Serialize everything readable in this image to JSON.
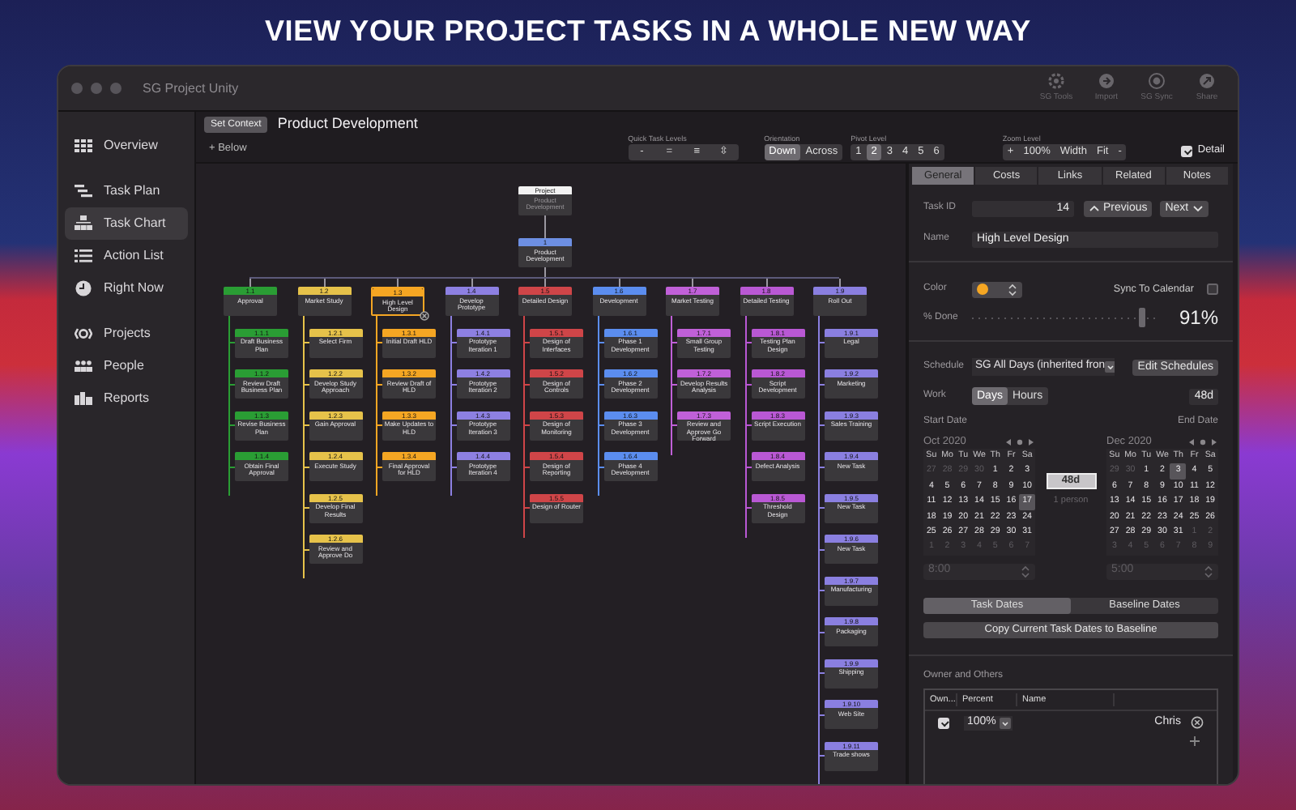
{
  "headline": "VIEW YOUR PROJECT TASKS IN A WHOLE NEW WAY",
  "window": {
    "title": "SG Project Unity"
  },
  "toolbar": [
    {
      "label": "SG Tools"
    },
    {
      "label": "Import"
    },
    {
      "label": "SG Sync"
    },
    {
      "label": "Share"
    }
  ],
  "sidebar": {
    "groups": [
      [
        {
          "label": "Overview",
          "selected": false
        }
      ],
      [
        {
          "label": "Task Plan",
          "selected": false
        },
        {
          "label": "Task Chart",
          "selected": true
        },
        {
          "label": "Action List",
          "selected": false
        },
        {
          "label": "Right Now",
          "selected": false
        }
      ],
      [
        {
          "label": "Projects",
          "selected": false
        },
        {
          "label": "People",
          "selected": false
        },
        {
          "label": "Reports",
          "selected": false
        }
      ]
    ]
  },
  "context": {
    "button": "Set Context",
    "title": "Product Development",
    "add_button": "+ Below"
  },
  "controls": {
    "quick_levels": {
      "label": "Quick Task Levels",
      "buttons": [
        "-",
        "=",
        "≡",
        "⇳"
      ]
    },
    "orientation": {
      "label": "Orientation",
      "options": [
        {
          "label": "Down",
          "selected": true
        },
        {
          "label": "Across",
          "selected": false
        }
      ]
    },
    "pivot": {
      "label": "Pivot Level",
      "options": [
        {
          "label": "1",
          "selected": false
        },
        {
          "label": "2",
          "selected": true
        },
        {
          "label": "3",
          "selected": false
        },
        {
          "label": "4",
          "selected": false
        },
        {
          "label": "5",
          "selected": false
        },
        {
          "label": "6",
          "selected": false
        }
      ]
    },
    "zoom": {
      "label": "Zoom Level",
      "buttons": [
        "+",
        "100%",
        "Width",
        "Fit",
        "-"
      ]
    },
    "detail": {
      "label": "Detail",
      "checked": true
    }
  },
  "chart": {
    "project": {
      "label": "Project",
      "name": "Product Development",
      "selected": false,
      "children": [
        {
          "number": "1",
          "name": "Product Development",
          "color": "#6d8fe3",
          "selected": false,
          "children": [
            {
              "number": "1.1",
              "name": "Approval",
              "color": "#2a9d34",
              "selected": false,
              "children": [
                {
                  "number": "1.1.1",
                  "name": "Draft Business Plan",
                  "selected": false
                },
                {
                  "number": "1.1.2",
                  "name": "Review Draft Business Plan",
                  "selected": false
                },
                {
                  "number": "1.1.3",
                  "name": "Revise Business Plan",
                  "selected": false
                },
                {
                  "number": "1.1.4",
                  "name": "Obtain Final Approval",
                  "selected": false
                }
              ]
            },
            {
              "number": "1.2",
              "name": "Market Study",
              "color": "#e6c24a",
              "selected": false,
              "children": [
                {
                  "number": "1.2.1",
                  "name": "Select Firm",
                  "selected": false
                },
                {
                  "number": "1.2.2",
                  "name": "Develop Study Approach",
                  "selected": false
                },
                {
                  "number": "1.2.3",
                  "name": "Gain Approval",
                  "selected": false
                },
                {
                  "number": "1.2.4",
                  "name": "Execute Study",
                  "selected": false
                },
                {
                  "number": "1.2.5",
                  "name": "Develop Final Results",
                  "selected": false
                },
                {
                  "number": "1.2.6",
                  "name": "Review and Approve Do",
                  "selected": false
                }
              ]
            },
            {
              "number": "1.3",
              "name": "High Level Design",
              "color": "#f5a623",
              "selected": true,
              "children": [
                {
                  "number": "1.3.1",
                  "name": "Initial Draft HLD",
                  "selected": false
                },
                {
                  "number": "1.3.2",
                  "name": "Review Draft of HLD",
                  "selected": false
                },
                {
                  "number": "1.3.3",
                  "name": "Make Updates to HLD",
                  "selected": false
                },
                {
                  "number": "1.3.4",
                  "name": "Final Approval for HLD",
                  "selected": false
                }
              ]
            },
            {
              "number": "1.4",
              "name": "Develop Prototype",
              "color": "#8d80e2",
              "selected": false,
              "children": [
                {
                  "number": "1.4.1",
                  "name": "Prototype Iteration 1",
                  "selected": false
                },
                {
                  "number": "1.4.2",
                  "name": "Prototype Iteration 2",
                  "selected": false
                },
                {
                  "number": "1.4.3",
                  "name": "Prototype Iteration 3",
                  "selected": false
                },
                {
                  "number": "1.4.4",
                  "name": "Prototype Iteration 4",
                  "selected": false
                }
              ]
            },
            {
              "number": "1.5",
              "name": "Detailed Design",
              "color": "#cf4548",
              "selected": false,
              "children": [
                {
                  "number": "1.5.1",
                  "name": "Design of Interfaces",
                  "selected": false
                },
                {
                  "number": "1.5.2",
                  "name": "Design of Controls",
                  "selected": false
                },
                {
                  "number": "1.5.3",
                  "name": "Design of Monitoring",
                  "selected": false
                },
                {
                  "number": "1.5.4",
                  "name": "Design of Reporting",
                  "selected": false
                },
                {
                  "number": "1.5.5",
                  "name": "Design of Router",
                  "selected": false
                }
              ]
            },
            {
              "number": "1.6",
              "name": "Development",
              "color": "#5b8def",
              "selected": false,
              "children": [
                {
                  "number": "1.6.1",
                  "name": "Phase 1 Development",
                  "selected": false
                },
                {
                  "number": "1.6.2",
                  "name": "Phase 2 Development",
                  "selected": false
                },
                {
                  "number": "1.6.3",
                  "name": "Phase 3 Development",
                  "selected": false
                },
                {
                  "number": "1.6.4",
                  "name": "Phase 4 Development",
                  "selected": false
                }
              ]
            },
            {
              "number": "1.7",
              "name": "Market Testing",
              "color": "#c060d8",
              "selected": false,
              "children": [
                {
                  "number": "1.7.1",
                  "name": "Small Group Testing",
                  "selected": false
                },
                {
                  "number": "1.7.2",
                  "name": "Develop Results Analysis",
                  "selected": false
                },
                {
                  "number": "1.7.3",
                  "name": "Review and Approve Go Forward",
                  "selected": false
                }
              ]
            },
            {
              "number": "1.8",
              "name": "Detailed Testing",
              "color": "#b958d4",
              "selected": false,
              "children": [
                {
                  "number": "1.8.1",
                  "name": "Testing Plan Design",
                  "selected": false
                },
                {
                  "number": "1.8.2",
                  "name": "Script Development",
                  "selected": false
                },
                {
                  "number": "1.8.3",
                  "name": "Script Execution",
                  "selected": false
                },
                {
                  "number": "1.8.4",
                  "name": "Defect Analysis",
                  "selected": false
                },
                {
                  "number": "1.8.5",
                  "name": "Threshold Design",
                  "selected": false
                }
              ]
            },
            {
              "number": "1.9",
              "name": "Roll Out",
              "color": "#8a7fe0",
              "selected": false,
              "children": [
                {
                  "number": "1.9.1",
                  "name": "Legal",
                  "selected": false
                },
                {
                  "number": "1.9.2",
                  "name": "Marketing",
                  "selected": false
                },
                {
                  "number": "1.9.3",
                  "name": "Sales Training",
                  "selected": false
                },
                {
                  "number": "1.9.4",
                  "name": "New Task",
                  "selected": false
                },
                {
                  "number": "1.9.5",
                  "name": "New Task",
                  "selected": false
                },
                {
                  "number": "1.9.6",
                  "name": "New Task",
                  "selected": false
                },
                {
                  "number": "1.9.7",
                  "name": "Manufacturing",
                  "selected": false
                },
                {
                  "number": "1.9.8",
                  "name": "Packaging",
                  "selected": false
                },
                {
                  "number": "1.9.9",
                  "name": "Shipping",
                  "selected": false
                },
                {
                  "number": "1.9.10",
                  "name": "Web Site",
                  "selected": false
                },
                {
                  "number": "1.9.11",
                  "name": "Trade shows",
                  "selected": false
                }
              ]
            }
          ]
        }
      ]
    }
  },
  "inspector": {
    "tabs": [
      {
        "label": "General",
        "selected": true
      },
      {
        "label": "Costs",
        "selected": false
      },
      {
        "label": "Links",
        "selected": false
      },
      {
        "label": "Related",
        "selected": false
      },
      {
        "label": "Notes",
        "selected": false
      }
    ],
    "task_id": {
      "label": "Task ID",
      "value": "14"
    },
    "previous": "Previous",
    "next": "Next",
    "name": {
      "label": "Name",
      "value": "High Level Design"
    },
    "color": {
      "label": "Color",
      "color": "#f5a623"
    },
    "sync": {
      "label": "Sync To Calendar",
      "checked": false
    },
    "done": {
      "label": "% Done",
      "level": 0.91,
      "reading": "91%"
    },
    "schedule": {
      "label": "Schedule",
      "value": "SG All Days (inherited fron",
      "button": "Edit Schedules"
    },
    "work": {
      "label": "Work",
      "units": [
        {
          "label": "Days",
          "selected": true
        },
        {
          "label": "Hours",
          "selected": false
        }
      ],
      "value": "48d"
    },
    "start": {
      "label": "Start Date",
      "time": {
        "value": "8:00",
        "disabled": true
      },
      "calendar": {
        "month": "Oct 2020",
        "weekdays": [
          "Su",
          "Mo",
          "Tu",
          "We",
          "Th",
          "Fr",
          "Sa"
        ],
        "days": [
          {
            "day": "27",
            "muted": true,
            "selected": false
          },
          {
            "day": "28",
            "muted": true,
            "selected": false
          },
          {
            "day": "29",
            "muted": true,
            "selected": false
          },
          {
            "day": "30",
            "muted": true,
            "selected": false
          },
          {
            "day": "1",
            "muted": false,
            "selected": false
          },
          {
            "day": "2",
            "muted": false,
            "selected": false
          },
          {
            "day": "3",
            "muted": false,
            "selected": false
          },
          {
            "day": "4",
            "muted": false,
            "selected": false
          },
          {
            "day": "5",
            "muted": false,
            "selected": false
          },
          {
            "day": "6",
            "muted": false,
            "selected": false
          },
          {
            "day": "7",
            "muted": false,
            "selected": false
          },
          {
            "day": "8",
            "muted": false,
            "selected": false
          },
          {
            "day": "9",
            "muted": false,
            "selected": false
          },
          {
            "day": "10",
            "muted": false,
            "selected": false
          },
          {
            "day": "11",
            "muted": false,
            "selected": false
          },
          {
            "day": "12",
            "muted": false,
            "selected": false
          },
          {
            "day": "13",
            "muted": false,
            "selected": false
          },
          {
            "day": "14",
            "muted": false,
            "selected": false
          },
          {
            "day": "15",
            "muted": false,
            "selected": false
          },
          {
            "day": "16",
            "muted": false,
            "selected": false
          },
          {
            "day": "17",
            "muted": false,
            "selected": true
          },
          {
            "day": "18",
            "muted": false,
            "selected": false
          },
          {
            "day": "19",
            "muted": false,
            "selected": false
          },
          {
            "day": "20",
            "muted": false,
            "selected": false
          },
          {
            "day": "21",
            "muted": false,
            "selected": false
          },
          {
            "day": "22",
            "muted": false,
            "selected": false
          },
          {
            "day": "23",
            "muted": false,
            "selected": false
          },
          {
            "day": "24",
            "muted": false,
            "selected": false
          },
          {
            "day": "25",
            "muted": false,
            "selected": false
          },
          {
            "day": "26",
            "muted": false,
            "selected": false
          },
          {
            "day": "27",
            "muted": false,
            "selected": false
          },
          {
            "day": "28",
            "muted": false,
            "selected": false
          },
          {
            "day": "29",
            "muted": false,
            "selected": false
          },
          {
            "day": "30",
            "muted": false,
            "selected": false
          },
          {
            "day": "31",
            "muted": false,
            "selected": false
          },
          {
            "day": "1",
            "muted": true,
            "selected": false
          },
          {
            "day": "2",
            "muted": true,
            "selected": false
          },
          {
            "day": "3",
            "muted": true,
            "selected": false
          },
          {
            "day": "4",
            "muted": true,
            "selected": false
          },
          {
            "day": "5",
            "muted": true,
            "selected": false
          },
          {
            "day": "6",
            "muted": true,
            "selected": false
          },
          {
            "day": "7",
            "muted": true,
            "selected": false
          }
        ]
      }
    },
    "end": {
      "label": "End Date",
      "time": {
        "value": "5:00",
        "disabled": true
      },
      "calendar": {
        "month": "Dec 2020",
        "weekdays": [
          "Su",
          "Mo",
          "Tu",
          "We",
          "Th",
          "Fr",
          "Sa"
        ],
        "days": [
          {
            "day": "29",
            "muted": true,
            "selected": false
          },
          {
            "day": "30",
            "muted": true,
            "selected": false
          },
          {
            "day": "1",
            "muted": false,
            "selected": false
          },
          {
            "day": "2",
            "muted": false,
            "selected": false
          },
          {
            "day": "3",
            "muted": false,
            "selected": true
          },
          {
            "day": "4",
            "muted": false,
            "selected": false
          },
          {
            "day": "5",
            "muted": false,
            "selected": false
          },
          {
            "day": "6",
            "muted": false,
            "selected": false
          },
          {
            "day": "7",
            "muted": false,
            "selected": false
          },
          {
            "day": "8",
            "muted": false,
            "selected": false
          },
          {
            "day": "9",
            "muted": false,
            "selected": false
          },
          {
            "day": "10",
            "muted": false,
            "selected": false
          },
          {
            "day": "11",
            "muted": false,
            "selected": false
          },
          {
            "day": "12",
            "muted": false,
            "selected": false
          },
          {
            "day": "13",
            "muted": false,
            "selected": false
          },
          {
            "day": "14",
            "muted": false,
            "selected": false
          },
          {
            "day": "15",
            "muted": false,
            "selected": false
          },
          {
            "day": "16",
            "muted": false,
            "selected": false
          },
          {
            "day": "17",
            "muted": false,
            "selected": false
          },
          {
            "day": "18",
            "muted": false,
            "selected": false
          },
          {
            "day": "19",
            "muted": false,
            "selected": false
          },
          {
            "day": "20",
            "muted": false,
            "selected": false
          },
          {
            "day": "21",
            "muted": false,
            "selected": false
          },
          {
            "day": "22",
            "muted": false,
            "selected": false
          },
          {
            "day": "23",
            "muted": false,
            "selected": false
          },
          {
            "day": "24",
            "muted": false,
            "selected": false
          },
          {
            "day": "25",
            "muted": false,
            "selected": false
          },
          {
            "day": "26",
            "muted": false,
            "selected": false
          },
          {
            "day": "27",
            "muted": false,
            "selected": false
          },
          {
            "day": "28",
            "muted": false,
            "selected": false
          },
          {
            "day": "29",
            "muted": false,
            "selected": false
          },
          {
            "day": "30",
            "muted": false,
            "selected": false
          },
          {
            "day": "31",
            "muted": false,
            "selected": false
          },
          {
            "day": "1",
            "muted": true,
            "selected": false
          },
          {
            "day": "2",
            "muted": true,
            "selected": false
          },
          {
            "day": "3",
            "muted": true,
            "selected": false
          },
          {
            "day": "4",
            "muted": true,
            "selected": false
          },
          {
            "day": "5",
            "muted": true,
            "selected": false
          },
          {
            "day": "6",
            "muted": true,
            "selected": false
          },
          {
            "day": "7",
            "muted": true,
            "selected": false
          },
          {
            "day": "8",
            "muted": true,
            "selected": false
          },
          {
            "day": "9",
            "muted": true,
            "selected": false
          }
        ]
      }
    },
    "duration": "48d",
    "resources": "1 person",
    "date_modes": [
      {
        "label": "Task Dates",
        "selected": true
      },
      {
        "label": "Baseline Dates",
        "selected": false
      }
    ],
    "copy_button": "Copy Current Task Dates to Baseline",
    "owners": {
      "label": "Owner and Others",
      "columns": [
        "Own...",
        "Percent",
        "Name"
      ],
      "rows": [
        {
          "owner": true,
          "percent": "100%",
          "name": "Chris"
        }
      ]
    }
  }
}
